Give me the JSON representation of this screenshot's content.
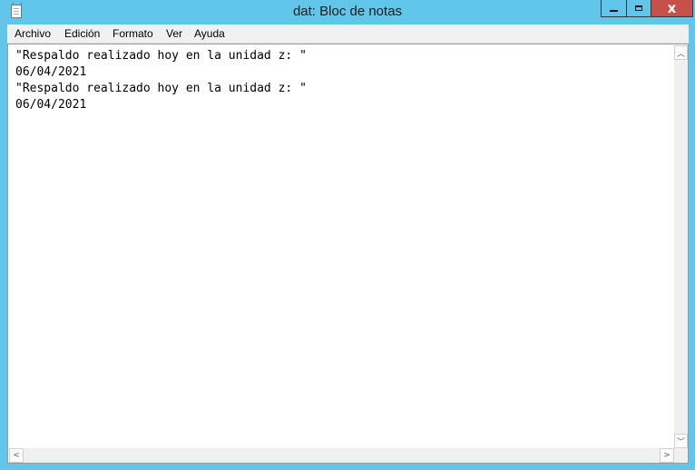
{
  "window": {
    "title": "dat: Bloc de notas",
    "icon": "notepad-icon",
    "controls": {
      "minimize_icon": "minimize-icon",
      "maximize_icon": "maximize-icon",
      "close_glyph": "x"
    },
    "colors": {
      "frame": "#62c6ea",
      "close": "#c7504b"
    }
  },
  "menu": {
    "items": [
      {
        "label": "Archivo"
      },
      {
        "label": "Edición"
      },
      {
        "label": "Formato"
      },
      {
        "label": "Ver"
      },
      {
        "label": "Ayuda"
      }
    ]
  },
  "document": {
    "lines": [
      "\"Respaldo realizado hoy en la unidad z: \"",
      "06/04/2021",
      "\"Respaldo realizado hoy en la unidad z: \"",
      "06/04/2021"
    ]
  },
  "scrollbars": {
    "up_glyph": "︿",
    "down_glyph": "﹀",
    "left_glyph": "<",
    "right_glyph": ">"
  }
}
